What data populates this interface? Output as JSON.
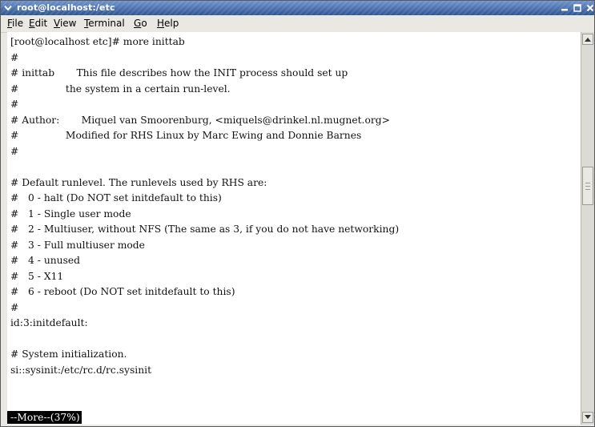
{
  "window": {
    "title": "root@localhost:/etc",
    "menu_icon": "chevron-down-icon",
    "controls": [
      "minimize-icon",
      "maximize-icon",
      "close-icon"
    ]
  },
  "menubar": {
    "items": [
      "File",
      "Edit",
      "View",
      "Terminal",
      "Go",
      "Help"
    ]
  },
  "terminal": {
    "lines": [
      "[root@localhost etc]# more inittab",
      "#",
      "# inittab       This file describes how the INIT process should set up",
      "#               the system in a certain run-level.",
      "#",
      "# Author:       Miquel van Smoorenburg, <miquels@drinkel.nl.mugnet.org>",
      "#               Modified for RHS Linux by Marc Ewing and Donnie Barnes",
      "#",
      "",
      "# Default runlevel. The runlevels used by RHS are:",
      "#   0 - halt (Do NOT set initdefault to this)",
      "#   1 - Single user mode",
      "#   2 - Multiuser, without NFS (The same as 3, if you do not have networking)",
      "#   3 - Full multiuser mode",
      "#   4 - unused",
      "#   5 - X11",
      "#   6 - reboot (Do NOT set initdefault to this)",
      "#",
      "id:3:initdefault:",
      "",
      "# System initialization.",
      "si::sysinit:/etc/rc.d/rc.sysinit"
    ],
    "pager_prompt": "--More--(37%)"
  },
  "scrollbar": {
    "position_fraction": 0.37,
    "up_icon": "arrow-up-icon",
    "down_icon": "arrow-down-icon"
  },
  "colors": {
    "titlebar": "#3a5f9c",
    "terminal_bg": "#ffffff",
    "terminal_fg": "#111111",
    "prompt_bg": "#000000"
  }
}
